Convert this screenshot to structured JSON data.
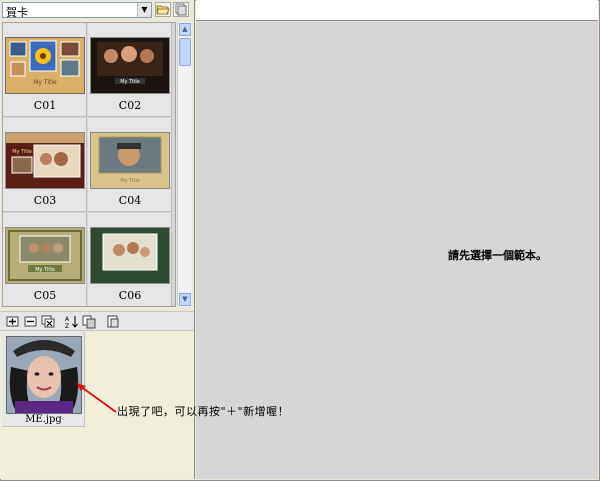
{
  "category_select": {
    "value": "賀卡",
    "arrow": "▼"
  },
  "toolbar": {
    "open_icon": "folder-open-icon",
    "manage_icon": "manage-templates-icon"
  },
  "templates": [
    {
      "label": "C01",
      "selected": true
    },
    {
      "label": "C02",
      "title": "My Title"
    },
    {
      "label": "C03",
      "title": "My Title"
    },
    {
      "label": "C04",
      "title": "My Title"
    },
    {
      "label": "C05",
      "title": "My Title"
    },
    {
      "label": "C06"
    }
  ],
  "c01_title": "My Title",
  "scrollbar": {
    "up": "▲",
    "down": "▼"
  },
  "photo_toolbar_icons": [
    "add-photo-icon",
    "remove-photo-icon",
    "remove-all-icon",
    "sort-icon",
    "copy-icon",
    "paste-icon"
  ],
  "photos": [
    {
      "label": "ME.jpg"
    }
  ],
  "preview": {
    "message": "請先選擇一個範本。"
  },
  "annotation": "出現了吧，可以再按\"＋\"新增喔！",
  "colors": {
    "preview_bg": "#d6d6d6",
    "panel_bg": "#ece9d8",
    "arrow": "#e01010"
  }
}
